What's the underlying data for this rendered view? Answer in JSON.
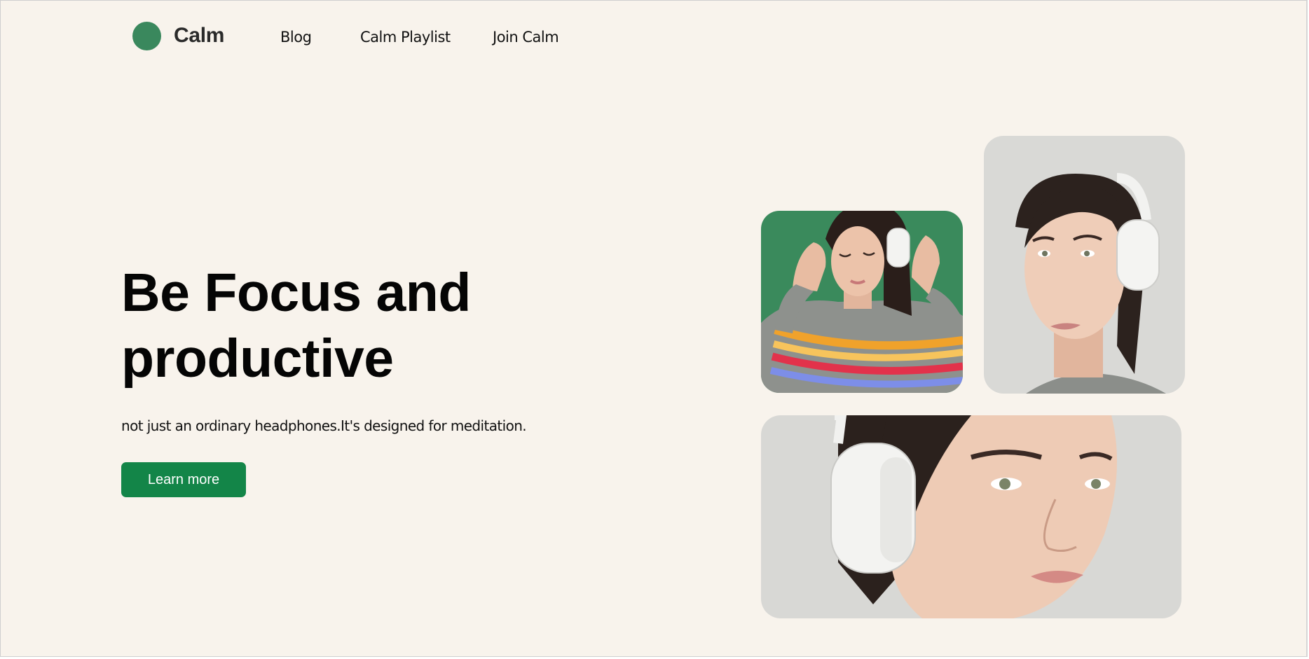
{
  "nav": {
    "brand": "Calm",
    "links": [
      {
        "label": "Blog"
      },
      {
        "label": "Calm Playlist"
      },
      {
        "label": "Join Calm"
      }
    ]
  },
  "hero": {
    "title_line1": "Be Focus and",
    "title_line2": "productive",
    "subtitle": "not just an ordinary headphones.It's designed for meditation.",
    "cta_label": "Learn more"
  },
  "colors": {
    "background": "#f8f3ec",
    "brand_green": "#3a885d",
    "button_green": "#138548",
    "photo_green_bg": "#3a8a5c",
    "photo_grey_bg": "#d9d9d6"
  },
  "images": [
    {
      "name": "woman-headphones-green-photo"
    },
    {
      "name": "woman-headphones-profile-photo"
    },
    {
      "name": "woman-headphones-closeup-photo"
    }
  ]
}
